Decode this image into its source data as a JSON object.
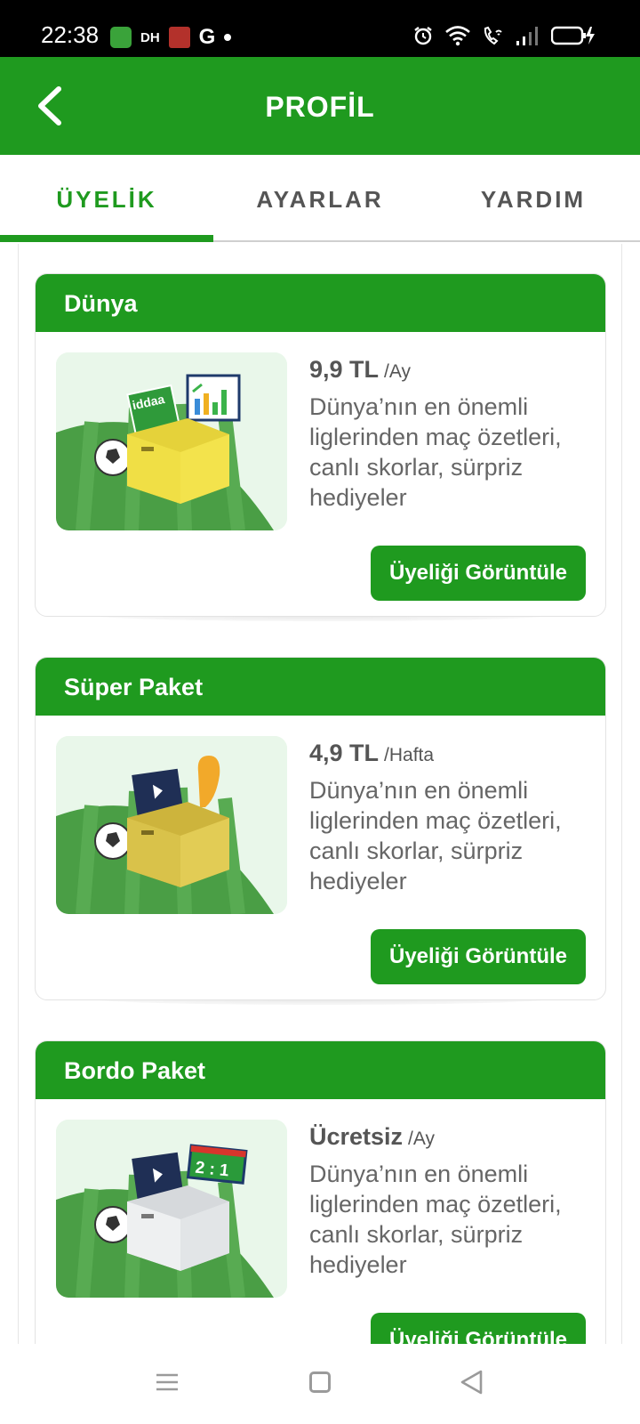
{
  "status_bar": {
    "time": "22:38",
    "left_icons": [
      "app-badge-icon",
      "dh-icon",
      "news-app-icon",
      "google-icon",
      "notification-dot-icon"
    ],
    "dh_label": "DH",
    "g_label": "G",
    "right_icons": [
      "alarm-icon",
      "wifi-icon",
      "wifi-calling-icon",
      "signal-icon",
      "battery-charging-icon"
    ]
  },
  "app_bar": {
    "title": "PROFİL",
    "back_icon": "chevron-left-icon"
  },
  "tabs": [
    {
      "label": "ÜYELİK",
      "active": true
    },
    {
      "label": "AYARLAR",
      "active": false
    },
    {
      "label": "YARDIM",
      "active": false
    }
  ],
  "packages": [
    {
      "name": "Dünya",
      "price": "9,9 TL",
      "period": "/Ay",
      "description": "Dünya’nın en önemli liglerinden maç özetleri, canlı skorlar, sürpriz hediyeler",
      "button": "Üyeliği Görüntüle",
      "illustration": "box-iddaa-chart-illustration"
    },
    {
      "name": "Süper Paket",
      "price": "4,9 TL",
      "period": "/Hafta",
      "description": "Dünya’nın en önemli liglerinden maç özetleri, canlı skorlar, sürpriz hediyeler",
      "button": "Üyeliği Görüntüle",
      "illustration": "box-video-trophy-illustration"
    },
    {
      "name": "Bordo Paket",
      "price": "Ücretsiz",
      "period": "/Ay",
      "description": "Dünya’nın en önemli liglerinden maç özetleri, canlı skorlar, sürpriz hediyeler",
      "button": "Üyeliği Görüntüle",
      "illustration": "box-video-scoreboard-illustration",
      "scoreboard": "2 : 1"
    }
  ],
  "colors": {
    "primary_green": "#1f9a1f",
    "text_gray": "#555555"
  },
  "nav_bar": {
    "icons": [
      "menu-icon",
      "home-square-icon",
      "back-triangle-icon"
    ]
  }
}
